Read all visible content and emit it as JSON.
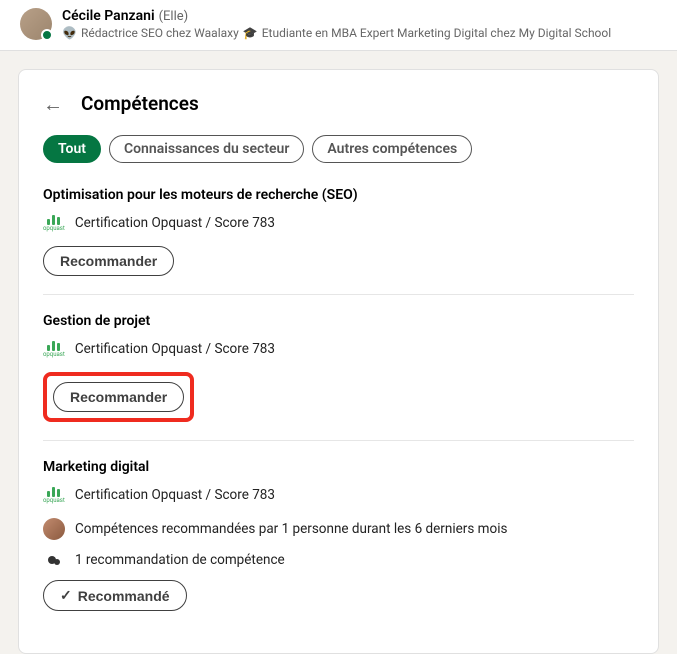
{
  "header": {
    "name": "Cécile Panzani",
    "pronoun": "(Elle)",
    "subtitle_prefix_emoji": "👽",
    "subtitle_part1": "Rédactrice SEO chez Waalaxy",
    "subtitle_mid_emoji": "🎓",
    "subtitle_part2": "Etudiante en MBA Expert Marketing Digital chez My Digital School"
  },
  "page": {
    "title": "Compétences"
  },
  "tabs": {
    "all": "Tout",
    "industry": "Connaissances du secteur",
    "other": "Autres compétences"
  },
  "skills": [
    {
      "title": "Optimisation pour les moteurs de recherche (SEO)",
      "cert": "Certification Opquast / Score 783",
      "recommend_label": "Recommander",
      "recommended": false,
      "highlighted": false,
      "endorsements": []
    },
    {
      "title": "Gestion de projet",
      "cert": "Certification Opquast / Score 783",
      "recommend_label": "Recommander",
      "recommended": false,
      "highlighted": true,
      "endorsements": []
    },
    {
      "title": "Marketing digital",
      "cert": "Certification Opquast / Score 783",
      "recommend_label": "Recommandé",
      "recommended": true,
      "highlighted": false,
      "endorsements": [
        {
          "type": "person",
          "text": "Compétences recommandées par 1 personne durant les 6 derniers mois"
        },
        {
          "type": "count",
          "text": "1 recommandation de compétence"
        }
      ]
    }
  ]
}
